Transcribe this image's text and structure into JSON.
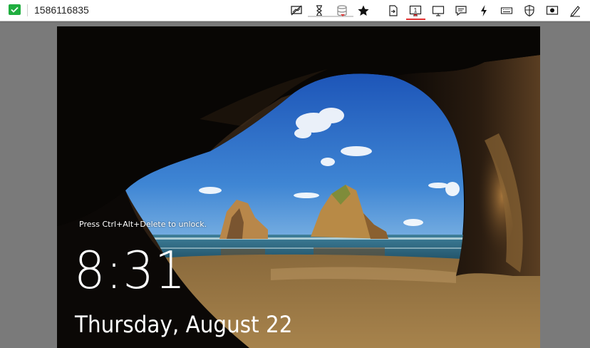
{
  "toolbar": {
    "session_id": "1586116835",
    "connection_status_color": "#1fae3f",
    "monitor_number": "1",
    "buttons": [
      {
        "name": "hide-wallpaper-icon"
      },
      {
        "name": "hourglass-icon"
      },
      {
        "name": "database-icon"
      },
      {
        "name": "star-icon"
      },
      {
        "name": "file-transfer-icon"
      },
      {
        "name": "monitor-select-icon"
      },
      {
        "name": "screen-icon"
      },
      {
        "name": "chat-icon"
      },
      {
        "name": "action-lightning-icon"
      },
      {
        "name": "keyboard-icon"
      },
      {
        "name": "shield-icon"
      },
      {
        "name": "record-icon"
      },
      {
        "name": "pen-icon"
      }
    ]
  },
  "lock_screen": {
    "unlock_hint": "Press Ctrl+Alt+Delete to unlock.",
    "time": "8:31",
    "date": "Thursday, August 22"
  }
}
